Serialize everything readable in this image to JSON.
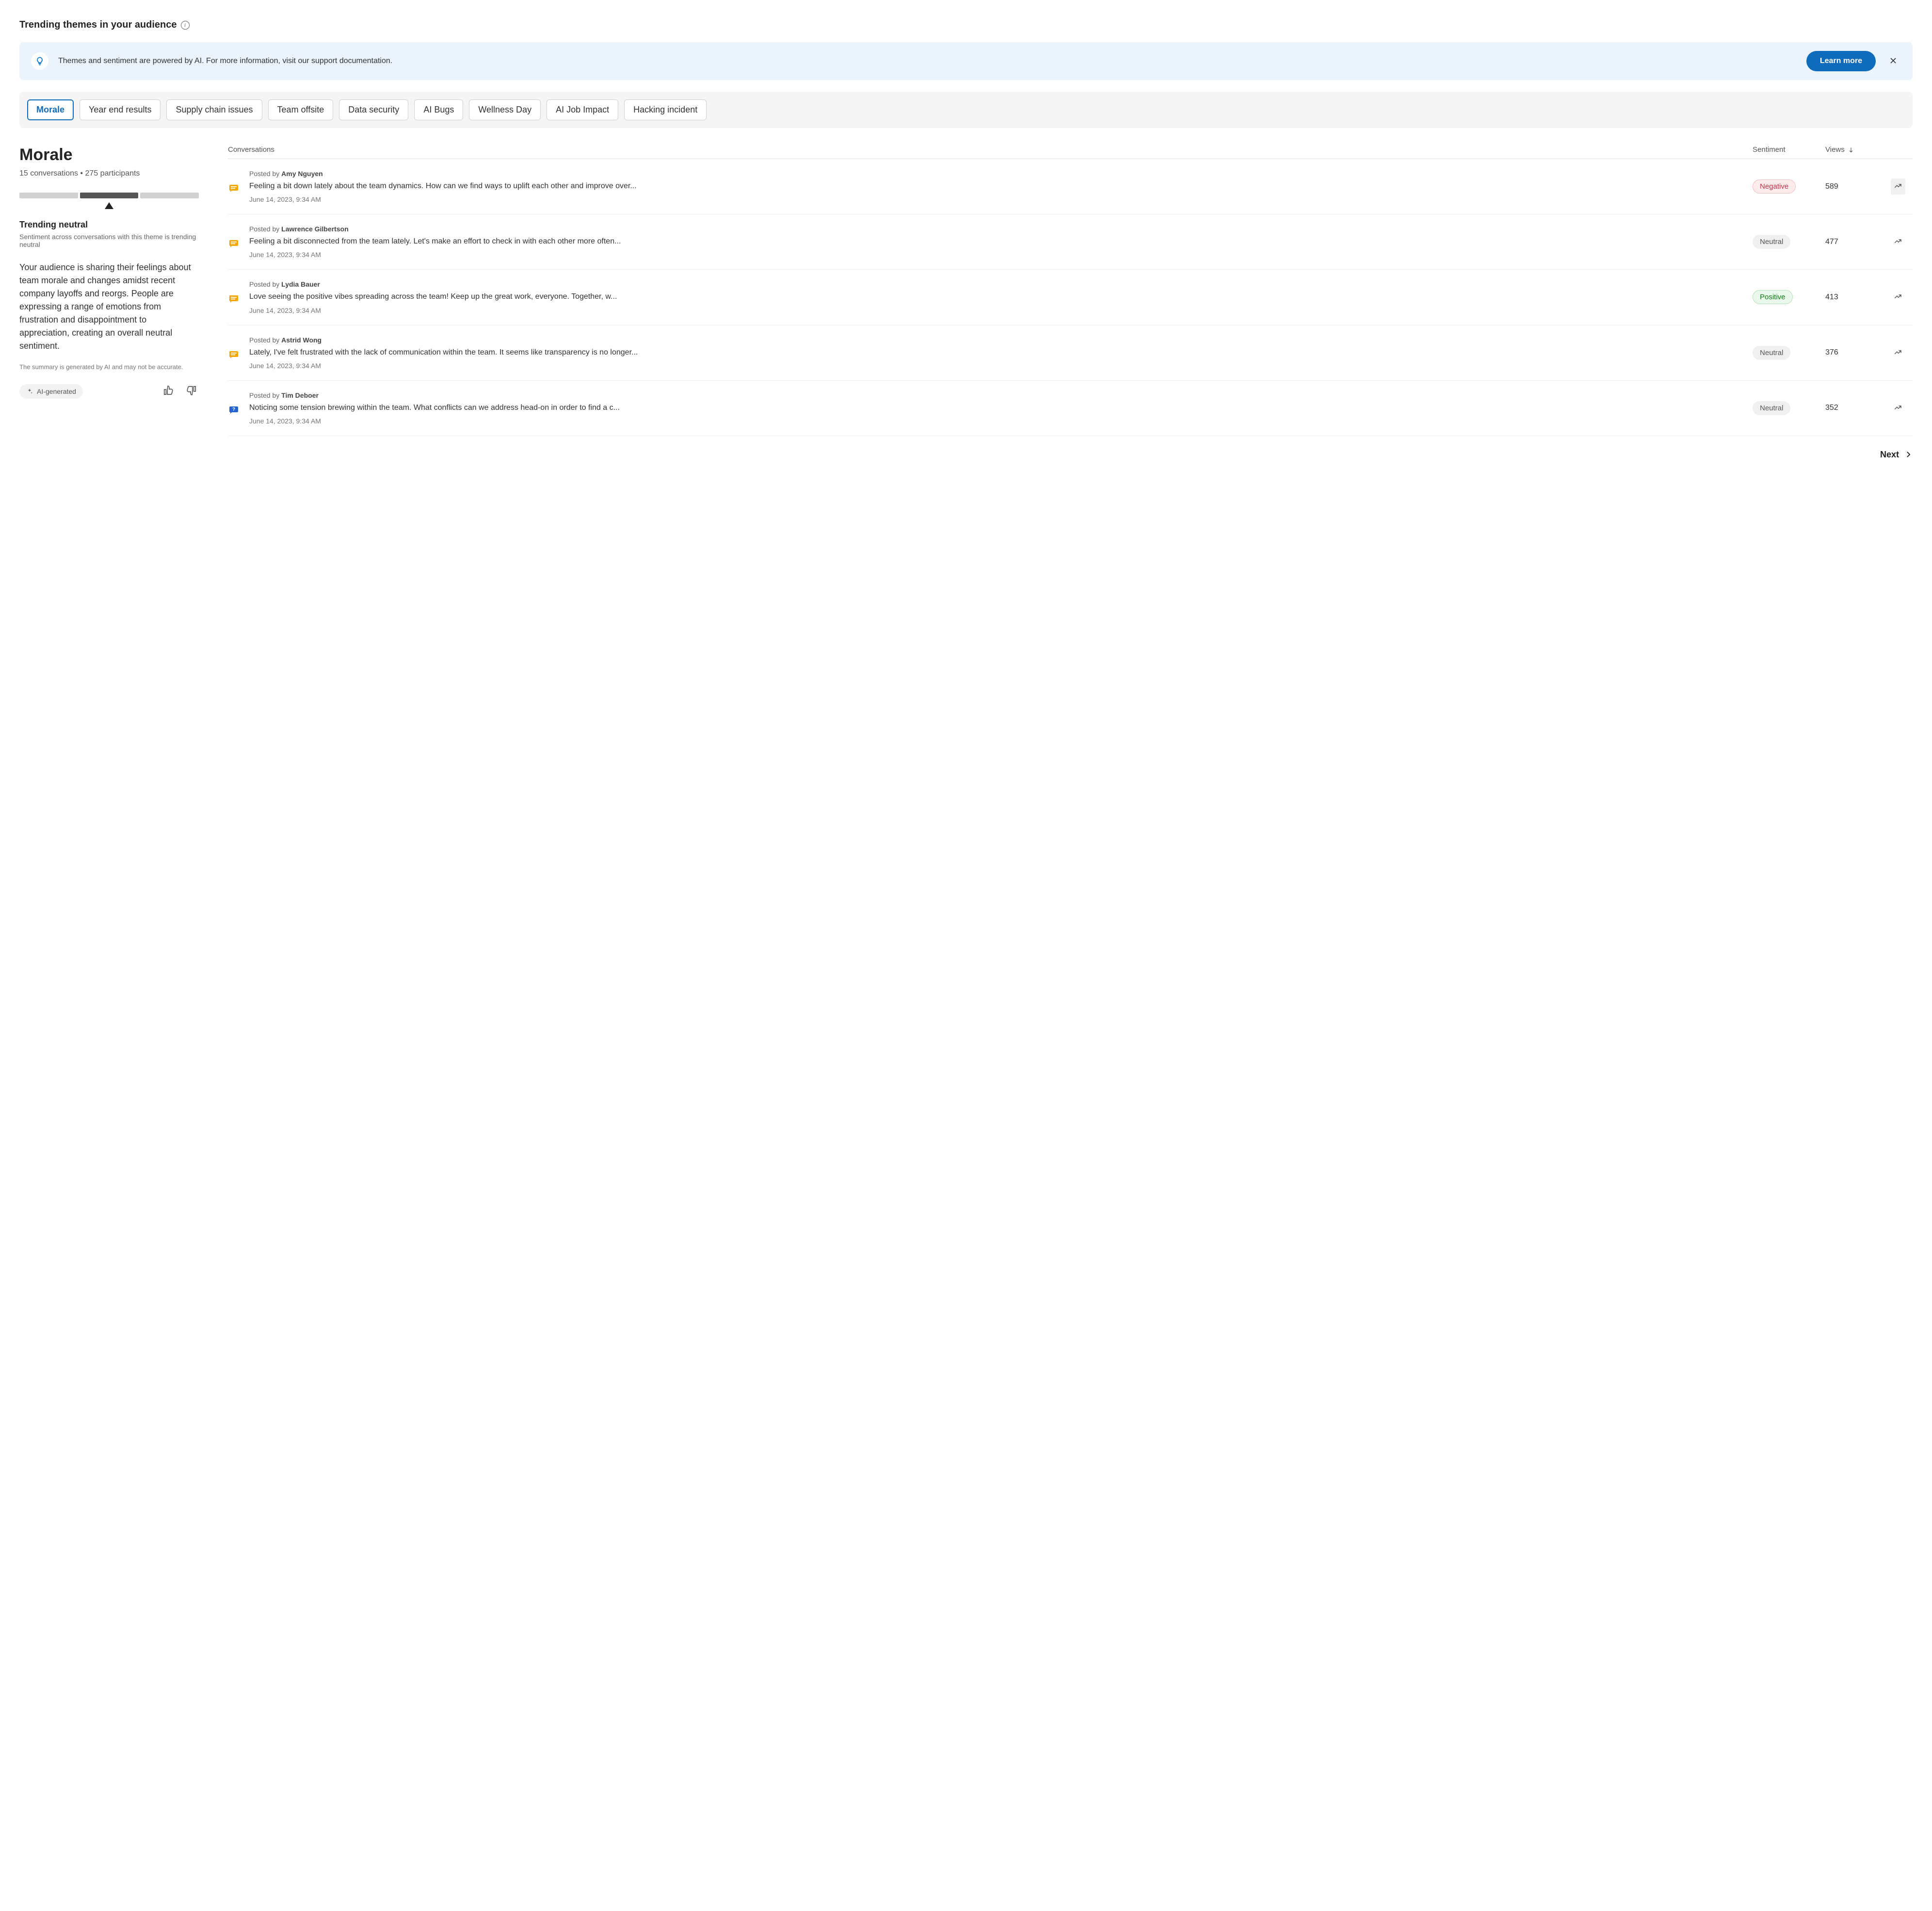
{
  "header": {
    "title": "Trending themes in your audience"
  },
  "banner": {
    "text": "Themes and sentiment are powered by AI. For more information, visit our support documentation.",
    "cta": "Learn more"
  },
  "themes": [
    {
      "label": "Morale",
      "active": true
    },
    {
      "label": "Year end results",
      "active": false
    },
    {
      "label": "Supply chain issues",
      "active": false
    },
    {
      "label": "Team offsite",
      "active": false
    },
    {
      "label": "Data security",
      "active": false
    },
    {
      "label": "AI Bugs",
      "active": false
    },
    {
      "label": "Wellness Day",
      "active": false
    },
    {
      "label": "AI Job Impact",
      "active": false
    },
    {
      "label": "Hacking incident",
      "active": false
    }
  ],
  "selected": {
    "name": "Morale",
    "stats": "15 conversations  •  275 participants",
    "trending_label": "Trending neutral",
    "trending_sub": "Sentiment across conversations with this theme is trending neutral",
    "summary": "Your audience is sharing their feelings about team morale and changes amidst recent company layoffs and reorgs. People are expressing a range of emotions from frustration and disappointment to appreciation, creating an overall neutral sentiment.",
    "disclaimer": "The summary is generated by AI and may not be accurate.",
    "ai_badge": "AI-generated"
  },
  "table": {
    "cols": {
      "conversations": "Conversations",
      "sentiment": "Sentiment",
      "views": "Views"
    },
    "posted_prefix": "Posted by ",
    "rows": [
      {
        "author": "Amy Nguyen",
        "snippet": "Feeling a bit down lately about the team dynamics. How can we find ways to uplift each other and improve over...",
        "timestamp": "June 14, 2023, 9:34 AM",
        "sentiment": "Negative",
        "sentiment_class": "negative",
        "views": "589",
        "icon": "chat",
        "hl": true
      },
      {
        "author": "Lawrence Gilbertson",
        "snippet": "Feeling a bit disconnected from the team lately. Let's make an effort to check in with each other more often...",
        "timestamp": "June 14, 2023, 9:34 AM",
        "sentiment": "Neutral",
        "sentiment_class": "neutral",
        "views": "477",
        "icon": "chat",
        "hl": false
      },
      {
        "author": "Lydia Bauer",
        "snippet": "Love seeing the positive vibes spreading across the team! Keep up the great work, everyone. Together, w...",
        "timestamp": "June 14, 2023, 9:34 AM",
        "sentiment": "Positive",
        "sentiment_class": "positive",
        "views": "413",
        "icon": "chat",
        "hl": false
      },
      {
        "author": "Astrid Wong",
        "snippet": "Lately, I've felt frustrated with the lack of communication within the team. It seems like transparency is no longer...",
        "timestamp": "June 14, 2023, 9:34 AM",
        "sentiment": "Neutral",
        "sentiment_class": "neutral",
        "views": "376",
        "icon": "chat",
        "hl": false
      },
      {
        "author": "Tim Deboer",
        "snippet": "Noticing some tension brewing within the team. What conflicts can we address head-on in order to find a c...",
        "timestamp": "June 14, 2023, 9:34 AM",
        "sentiment": "Neutral",
        "sentiment_class": "neutral",
        "views": "352",
        "icon": "question",
        "hl": false
      }
    ]
  },
  "pager": {
    "next": "Next"
  }
}
